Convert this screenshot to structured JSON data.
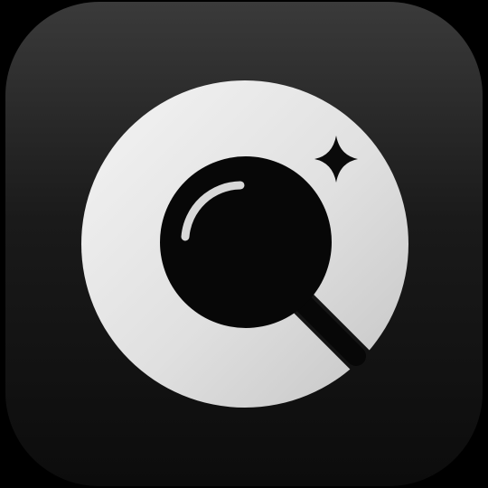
{
  "icon": {
    "name": "search-app-icon",
    "glyph": "magnifying-glass-icon",
    "accent": "sparkle-icon",
    "colors": {
      "page_background": "#000000",
      "tile_top": "#3a3a3a",
      "tile_bottom": "#0c0c0c",
      "ring_light": "#f4f4f4",
      "ring_dark": "#c4c4c4",
      "lens": "#070707",
      "highlight": "#d8d8d8",
      "sparkle": "#0a0a0a"
    }
  }
}
